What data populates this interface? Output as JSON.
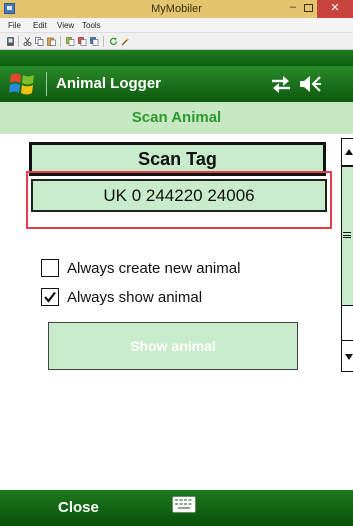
{
  "host_window": {
    "title": "MyMobiler",
    "min_glyph": "–",
    "close_glyph": "✕",
    "menu": [
      "File",
      "Edit",
      "View",
      "Tools"
    ]
  },
  "device": {
    "app_title": "Animal Logger",
    "header_icons": [
      "windows-logo-icon",
      "sync-icon",
      "volume-muted-icon"
    ]
  },
  "content": {
    "section_title": "Scan Animal",
    "scan_tag_label": "Scan Tag",
    "tag_value": "UK 0 244220 24006",
    "always_create_label": "Always create new animal",
    "always_create_checked": false,
    "always_show_label": "Always show animal",
    "always_show_checked": true,
    "show_animal_label": "Show animal"
  },
  "softkeys": {
    "left_label": "Close",
    "center_icon": "keyboard-icon"
  },
  "colors": {
    "accent_green": "#2e9a2e",
    "panel_green": "#c8eccb",
    "header_green": "#1d7a1d",
    "highlight_red": "#e0404a"
  }
}
